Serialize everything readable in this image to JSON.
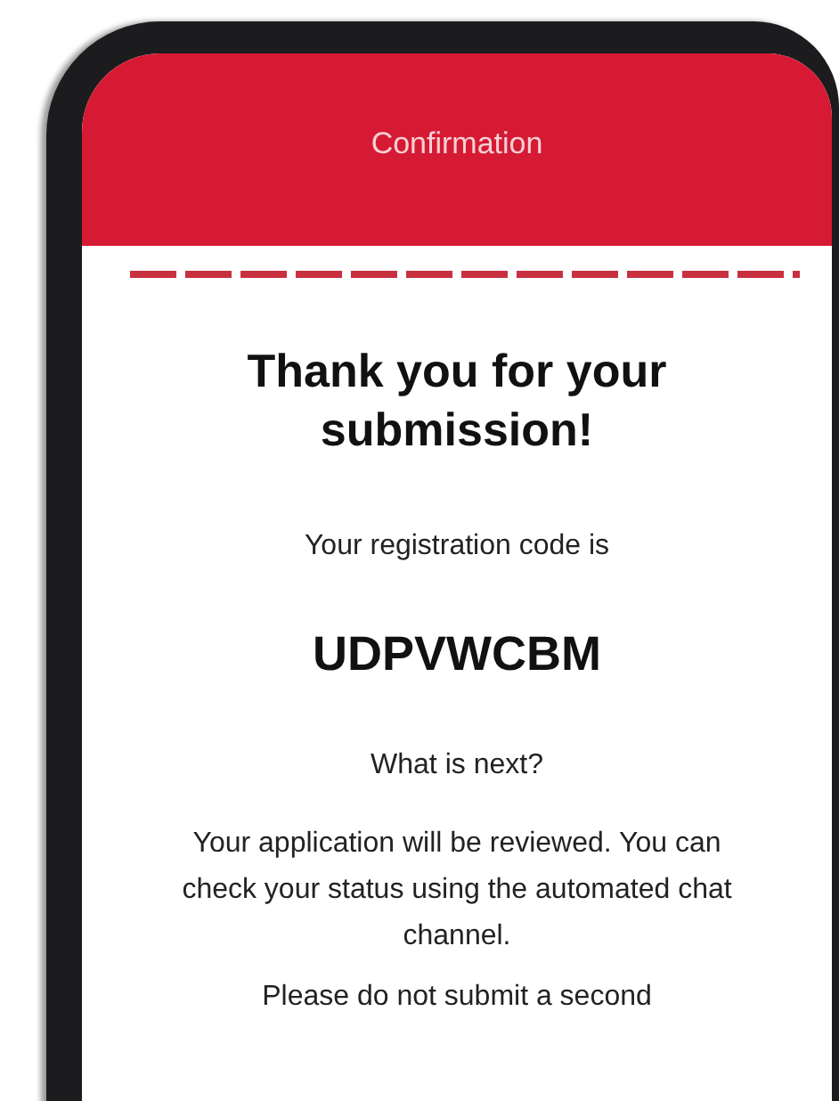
{
  "header": {
    "title": "Confirmation"
  },
  "heading": "Thank you for your submission!",
  "code_label": "Your registration code is",
  "code": "UDPVWCBM",
  "next_heading": "What is next?",
  "next_text": "Your application will be reviewed. You can check your status using the automated chat channel.",
  "notice": "Please do not submit a second"
}
